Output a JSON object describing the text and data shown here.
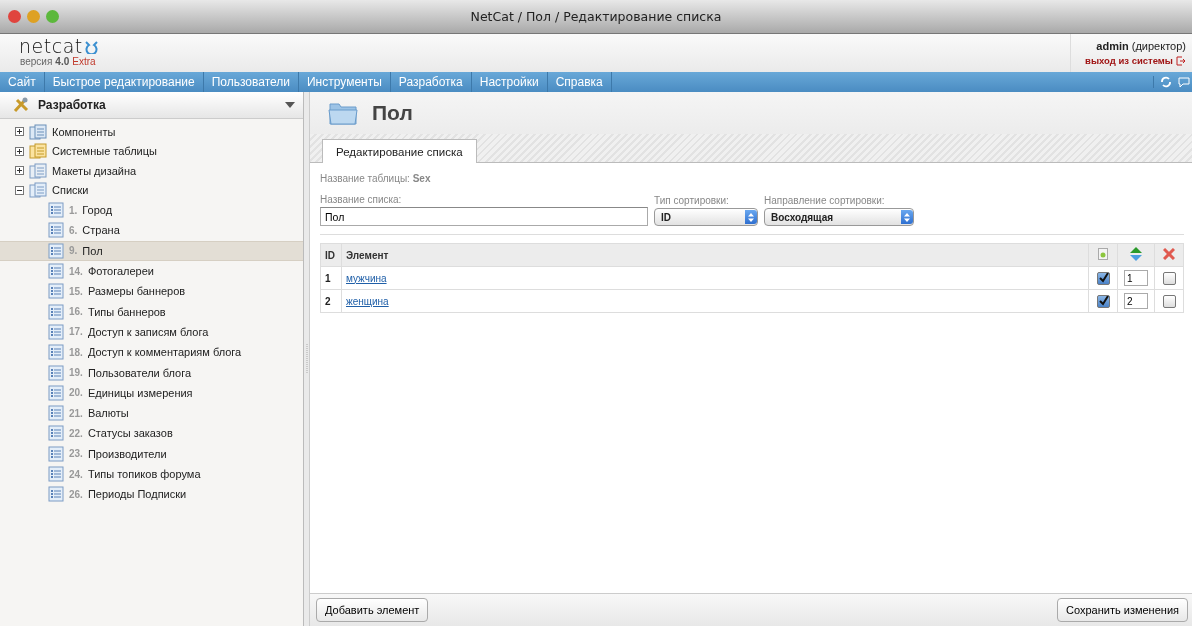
{
  "window": {
    "title": "NetCat / Пол / Редактирование списка"
  },
  "header": {
    "logo": "netcat",
    "version_label": "версия",
    "version_number": "4.0",
    "edition": "Extra",
    "user": "**admin** (директор)",
    "logout": "выход из системы"
  },
  "nav": [
    {
      "label": "Сайт"
    },
    {
      "label": "Быстрое редактирование"
    },
    {
      "label": "Пользователи"
    },
    {
      "label": "Инструменты"
    },
    {
      "label": "Разработка"
    },
    {
      "label": "Настройки"
    },
    {
      "label": "Справка"
    }
  ],
  "sidebar": {
    "title": "Разработка",
    "items": [
      {
        "label": "Компоненты",
        "kind": "components",
        "expanded": false
      },
      {
        "label": "Системные таблицы",
        "kind": "tables",
        "expanded": false
      },
      {
        "label": "Макеты дизайна",
        "kind": "templates",
        "expanded": false
      },
      {
        "label": "Списки",
        "kind": "lists",
        "expanded": true,
        "children": [
          {
            "number": "1.",
            "label": "Город",
            "selected": false
          },
          {
            "number": "6.",
            "label": "Страна",
            "selected": false
          },
          {
            "number": "9.",
            "label": "Пол",
            "selected": true
          },
          {
            "number": "14.",
            "label": "Фотогалереи",
            "selected": false
          },
          {
            "number": "15.",
            "label": "Размеры баннеров",
            "selected": false
          },
          {
            "number": "16.",
            "label": "Типы баннеров",
            "selected": false
          },
          {
            "number": "17.",
            "label": "Доступ к записям блога",
            "selected": false
          },
          {
            "number": "18.",
            "label": "Доступ к комментариям блога",
            "selected": false
          },
          {
            "number": "19.",
            "label": "Пользователи блога",
            "selected": false
          },
          {
            "number": "20.",
            "label": "Единицы измерения",
            "selected": false
          },
          {
            "number": "21.",
            "label": "Валюты",
            "selected": false
          },
          {
            "number": "22.",
            "label": "Статусы заказов",
            "selected": false
          },
          {
            "number": "23.",
            "label": "Производители",
            "selected": false
          },
          {
            "number": "24.",
            "label": "Типы топиков форума",
            "selected": false
          },
          {
            "number": "26.",
            "label": "Периоды Подписки",
            "selected": false
          }
        ]
      }
    ]
  },
  "page": {
    "title": "Пол",
    "tabs": [
      {
        "label": "Редактирование списка",
        "selected": true
      }
    ],
    "table_name": "Название таблицы: **Sex**",
    "list_name": {
      "label": "Название списка:",
      "value": "Пол"
    },
    "sort_type": {
      "label": "Тип сортировки:",
      "value": "ID"
    },
    "sort_direction": {
      "label": "Направление сортировки:",
      "value": "Восходящая"
    },
    "table": {
      "columns": [
        "ID",
        "Элемент"
      ],
      "rows": [
        {
          "id": "1",
          "element": "мужчина",
          "checked": true,
          "priority": "1",
          "delete": false
        },
        {
          "id": "2",
          "element": "женщина",
          "checked": true,
          "priority": "2",
          "delete": false
        }
      ]
    },
    "buttons": {
      "add": "Добавить элемент",
      "save": "Сохранить изменения"
    }
  }
}
